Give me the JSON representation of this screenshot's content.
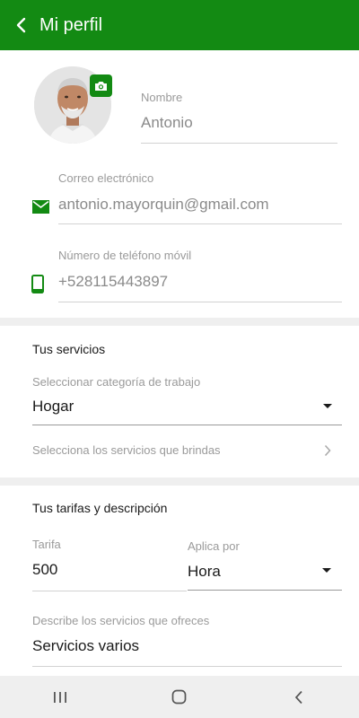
{
  "header": {
    "title": "Mi perfil",
    "back_icon": "arrow-back-icon",
    "color": "#138a13"
  },
  "profile": {
    "camera_icon": "camera-icon",
    "name": {
      "label": "Nombre",
      "value": "Antonio"
    },
    "email": {
      "label": "Correo electrónico",
      "value": "antonio.mayorquin@gmail.com",
      "icon": "mail-icon"
    },
    "phone": {
      "label": "Número de teléfono móvil",
      "value": "+528115443897",
      "icon": "phone-icon"
    }
  },
  "services": {
    "title": "Tus servicios",
    "category": {
      "label": "Seleccionar categoría de trabajo",
      "value": "Hogar"
    },
    "select_services": {
      "label": "Selecciona los servicios que brindas"
    }
  },
  "rates": {
    "title": "Tus tarifas y descripción",
    "rate": {
      "label": "Tarifa",
      "value": "500"
    },
    "applies": {
      "label": "Aplica por",
      "value": "Hora"
    },
    "description": {
      "label": "Describe los servicios que ofreces",
      "value": "Servicios varios"
    }
  },
  "navbar": {
    "icons": [
      "recent-apps-icon",
      "home-icon",
      "back-nav-icon"
    ]
  }
}
